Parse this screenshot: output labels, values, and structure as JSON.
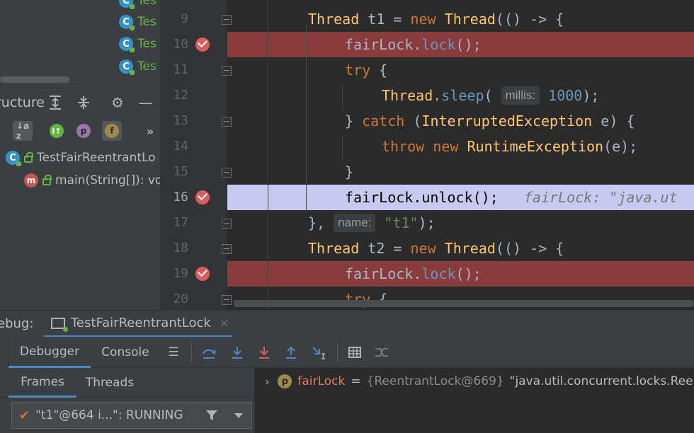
{
  "project": {
    "items": [
      "Tes",
      "Tes",
      "Tes",
      "Tes"
    ]
  },
  "structure": {
    "title": "ructure",
    "class_name": "TestFairReentrantLo",
    "method_name": "main(String[]): vo"
  },
  "editor": {
    "line_numbers": [
      "9",
      "10",
      "11",
      "12",
      "13",
      "14",
      "15",
      "16",
      "17",
      "18",
      "19",
      "20"
    ],
    "current_line": "16",
    "hints": {
      "millis": "millis:",
      "name": "name:"
    },
    "inline_value": "fairLock: \"java.ut"
  },
  "debug": {
    "label": "ebug:",
    "session_tab": "TestFairReentrantLock",
    "close_glyph": "×",
    "tabs": {
      "debugger": "Debugger",
      "console": "Console"
    },
    "frames_tabs": {
      "frames": "Frames",
      "threads": "Threads"
    },
    "thread_selector": "\"t1\"@664 i...\": RUNNING",
    "variable": {
      "name": "fairLock",
      "equals": "=",
      "type": "{ReentrantLock@669}",
      "value": "\"java.util.concurrent.locks.Reent"
    }
  },
  "colors": {
    "breakpoint": "#db5c5c",
    "breakpoint_line": "#8a3b3b",
    "current_line": "#c8c8f0",
    "accent": "#4a88c7"
  }
}
